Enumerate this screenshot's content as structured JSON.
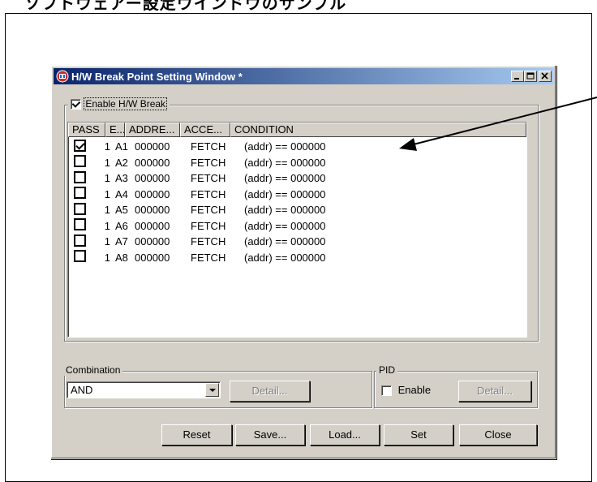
{
  "page": {
    "heading": "ソフトウェアー設定ウインドウのサンプル"
  },
  "window": {
    "title": "H/W Break Point Setting Window *",
    "buttons": {
      "minimize": "minimize",
      "maximize": "maximize",
      "close": "close"
    }
  },
  "enable_hw_break": {
    "label": "Enable H/W Break",
    "checked": true
  },
  "list": {
    "columns": [
      "PASS",
      "E...",
      "ADDRE...",
      "ACCE...",
      "CONDITION"
    ],
    "rows": [
      {
        "checked": true,
        "pass": "1",
        "event": "A1",
        "address": "000000",
        "access": "FETCH",
        "condition": "(addr) == 000000"
      },
      {
        "checked": false,
        "pass": "1",
        "event": "A2",
        "address": "000000",
        "access": "FETCH",
        "condition": "(addr) == 000000"
      },
      {
        "checked": false,
        "pass": "1",
        "event": "A3",
        "address": "000000",
        "access": "FETCH",
        "condition": "(addr) == 000000"
      },
      {
        "checked": false,
        "pass": "1",
        "event": "A4",
        "address": "000000",
        "access": "FETCH",
        "condition": "(addr) == 000000"
      },
      {
        "checked": false,
        "pass": "1",
        "event": "A5",
        "address": "000000",
        "access": "FETCH",
        "condition": "(addr) == 000000"
      },
      {
        "checked": false,
        "pass": "1",
        "event": "A6",
        "address": "000000",
        "access": "FETCH",
        "condition": "(addr) == 000000"
      },
      {
        "checked": false,
        "pass": "1",
        "event": "A7",
        "address": "000000",
        "access": "FETCH",
        "condition": "(addr) == 000000"
      },
      {
        "checked": false,
        "pass": "1",
        "event": "A8",
        "address": "000000",
        "access": "FETCH",
        "condition": "(addr) == 000000"
      }
    ]
  },
  "combination": {
    "label": "Combination",
    "value": "AND",
    "detail_label": "Detail..."
  },
  "pid": {
    "label": "PID",
    "enable_label": "Enable",
    "enable_checked": false,
    "detail_label": "Detail..."
  },
  "footer": {
    "reset": "Reset",
    "save": "Save...",
    "load": "Load...",
    "set": "Set",
    "close": "Close"
  },
  "colors": {
    "titlebar_start": "#0a246a",
    "titlebar_end": "#a6caf0",
    "dialog_face": "#d4d0c8"
  }
}
